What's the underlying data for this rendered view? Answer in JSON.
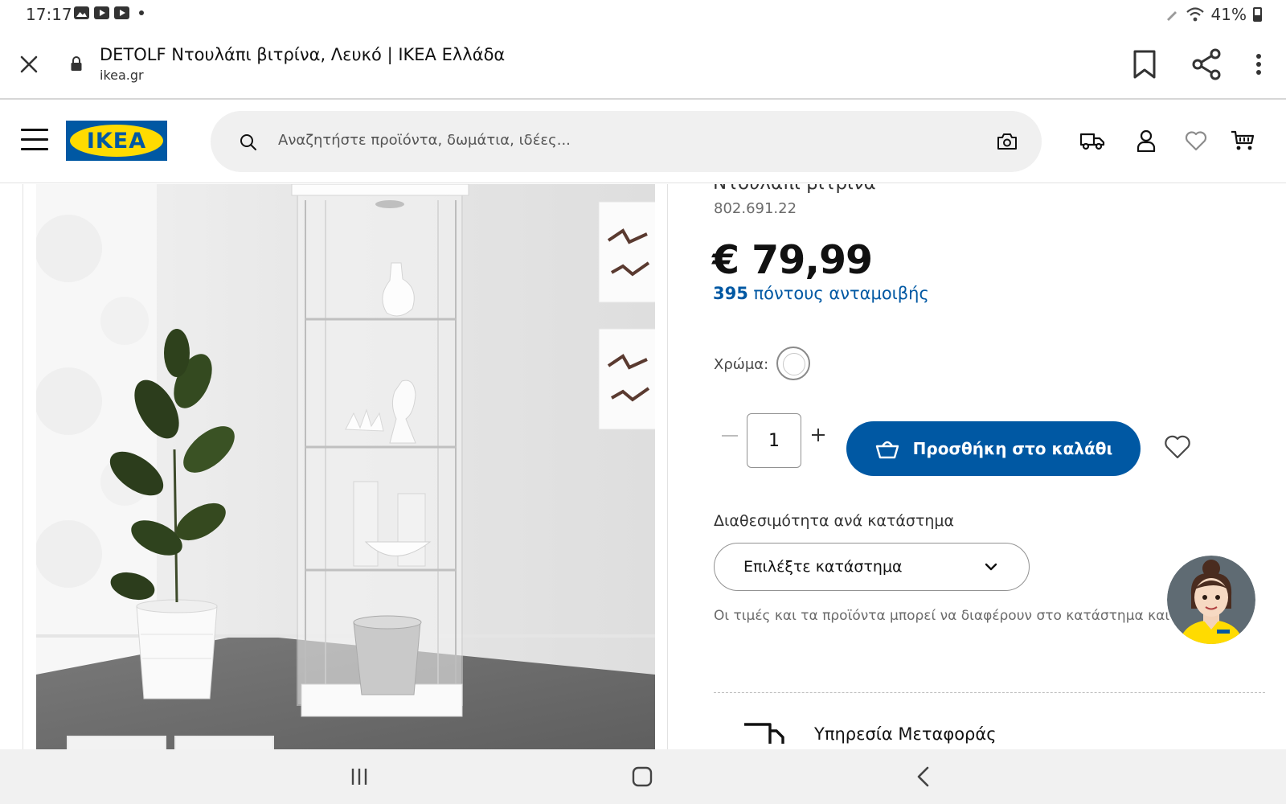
{
  "status_bar": {
    "time": "17:17",
    "battery": "41%",
    "battery_level": 0.41
  },
  "browser": {
    "page_title": "DETOLF Ντουλάπι βιτρίνα, Λευκό | IKEA Ελλάδα",
    "domain": "ikea.gr"
  },
  "header": {
    "logo_text": "IKEA",
    "search_placeholder": "Αναζητήστε προϊόντα, δωμάτια, ιδέες..."
  },
  "product": {
    "subtitle": "Ντουλάπι βιτρίνα",
    "article_number": "802.691.22",
    "price": "€ 79,99",
    "reward_points": "395",
    "reward_text": "πόντους ανταμοιβής",
    "color_label": "Χρώμα:",
    "quantity": "1",
    "add_to_cart_label": "Προσθήκη στο καλάθι",
    "store_availability_label": "Διαθεσιμότητα ανά κατάστημα",
    "store_select_placeholder": "Επιλέξτε κατάστημα",
    "disclaimer": "Οι τιμές και τα προϊόντα μπορεί να διαφέρουν στο κατάστημα και online.",
    "delivery_label": "Υπηρεσία Μεταφοράς"
  },
  "colors": {
    "ikea_blue": "#0058a3",
    "ikea_yellow": "#ffdb00"
  }
}
